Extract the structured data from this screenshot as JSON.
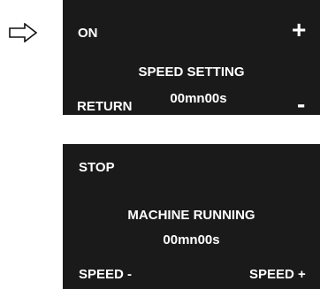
{
  "arrow_icon": "right-arrow-outline-icon",
  "screen1": {
    "on_label": "ON",
    "plus_label": "+",
    "title": "SPEED SETTING",
    "time": "00mn00s",
    "return_label": "RETURN",
    "minus_label": "-"
  },
  "screen2": {
    "stop_label": "STOP",
    "title": "MACHINE RUNNING",
    "time": "00mn00s",
    "speed_minus_label": "SPEED -",
    "speed_plus_label": "SPEED +"
  },
  "colors": {
    "screen_background": "#1a1a1a",
    "text": "#ffffff"
  }
}
